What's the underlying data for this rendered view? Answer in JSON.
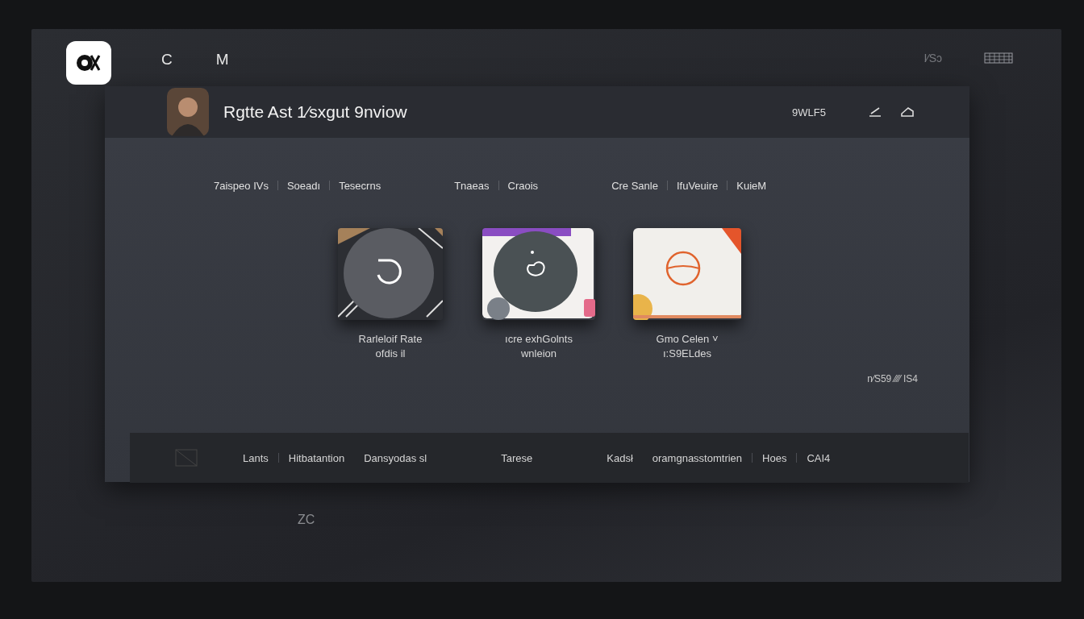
{
  "top_bar": {
    "nav": [
      "C",
      "M"
    ],
    "right_text": "I⁄Sↄ"
  },
  "panel": {
    "title": "Rgtte Ast 1⁄sxgut 9nviow",
    "header_text": "9WLF5",
    "tabs": [
      "7aispeo IVs",
      "Soeadı",
      "Tesecrns",
      "Tnaeas",
      "Craois",
      "Cre Sanle",
      "IfuVeuire",
      "KuieM"
    ],
    "cards": [
      {
        "kind": "dark",
        "caption": [
          "Rarleloif Rate",
          "ofdis il"
        ]
      },
      {
        "kind": "colorful",
        "caption": [
          "ıcre exhGolnts",
          "wnleion"
        ]
      },
      {
        "kind": "light",
        "caption": [
          "Gmo Celen ˅",
          "ı:S9ELdes"
        ]
      }
    ],
    "footnote": "n⁄S59 ⁄⁄⁄⁄ IS4"
  },
  "bottom_bar": {
    "items": [
      "Lants",
      "Hitbatantion",
      "Dansyodas sl",
      "Tarese",
      "Kadsł",
      "oramgnasstomtrien",
      "Hoes",
      "CAI4"
    ]
  },
  "footer_text": "ZC"
}
